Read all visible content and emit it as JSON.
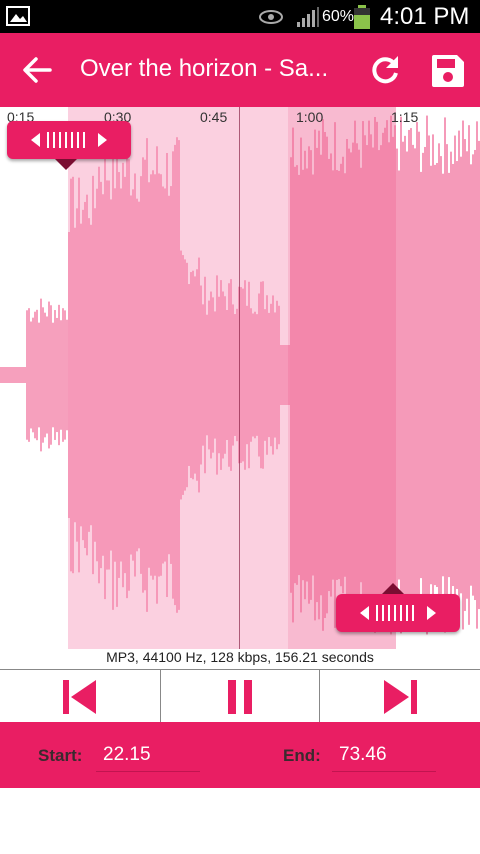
{
  "status_bar": {
    "battery_percent": "60%",
    "time": "4:01 PM",
    "icons": [
      "gallery-icon",
      "eye-icon",
      "signal-icon",
      "battery-icon"
    ]
  },
  "toolbar": {
    "title": "Over the horizon - Sa...",
    "icons": [
      "back-arrow-icon",
      "refresh-icon",
      "save-icon"
    ]
  },
  "timeline": {
    "ticks": [
      "0:15",
      "0:30",
      "0:45",
      "1:00",
      "1:15"
    ]
  },
  "track_info": "MP3, 44100 Hz, 128 kbps, 156.21 seconds",
  "controls": {
    "icons": [
      "skip-previous-icon",
      "pause-icon",
      "skip-next-icon"
    ]
  },
  "selection": {
    "start_label": "Start:",
    "start_value": "22.15",
    "end_label": "End:",
    "end_value": "73.46"
  },
  "colors": {
    "accent": "#e91e63",
    "wave": "#f48fb1",
    "selection_bg": "#fbd0e0"
  }
}
